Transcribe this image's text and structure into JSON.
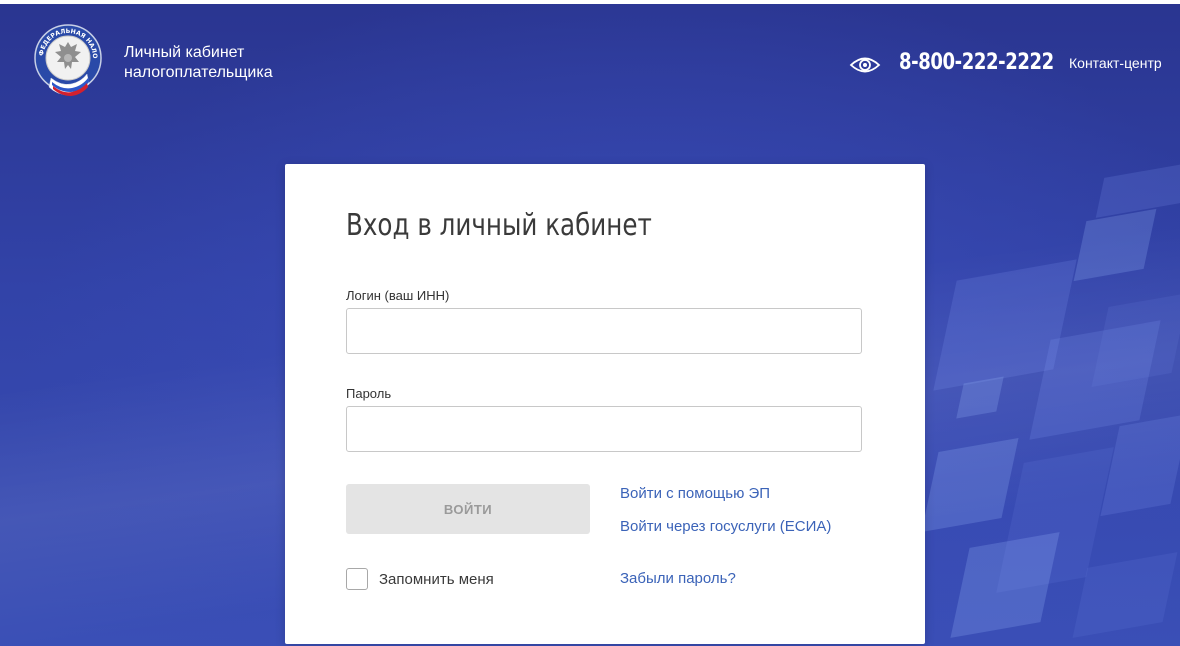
{
  "header": {
    "logo_text": "ФЕДЕРАЛЬНАЯ НАЛОГОВАЯ СЛУЖБА",
    "app_title_line1": "Личный кабинет",
    "app_title_line2": "налогоплательщика",
    "phone": "8-800-222-2222",
    "contact_label": "Контакт-центр",
    "vision_icon": "eye-icon"
  },
  "login_card": {
    "title": "Вход в личный кабинет",
    "login_label": "Логин (ваш ИНН)",
    "login_value": "",
    "password_label": "Пароль",
    "password_value": "",
    "submit_label": "ВОЙТИ",
    "ep_link": "Войти с помощью ЭП",
    "esia_link": "Войти через госуслуги (ЕСИА)",
    "remember_label": "Запомнить меня",
    "remember_checked": false,
    "forgot_link": "Забыли пароль?"
  },
  "colors": {
    "background": "#2f3fa3",
    "link": "#3b63b8",
    "button_disabled": "#e4e4e4"
  }
}
